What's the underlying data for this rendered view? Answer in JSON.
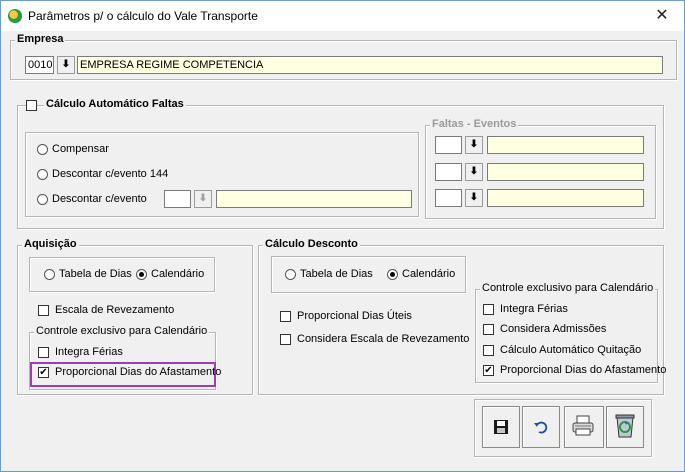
{
  "window": {
    "title": "Parâmetros p/ o cálculo do Vale Transporte",
    "close_glyph": "✕"
  },
  "empresa": {
    "legend": "Empresa",
    "code": "0010",
    "name": "EMPRESA REGIME COMPETENCIA",
    "lookup_glyph": "⬇"
  },
  "calculo_auto": {
    "checkbox_label": "Cálculo Automático Faltas",
    "checked": false,
    "options": [
      {
        "label": "Compensar",
        "selected": false
      },
      {
        "label": "Descontar c/evento 144",
        "selected": false
      },
      {
        "label": "Descontar c/evento",
        "selected": false
      }
    ],
    "evento_code": "",
    "evento_desc": ""
  },
  "faltas_eventos": {
    "legend": "Faltas - Eventos",
    "rows": [
      "",
      "",
      ""
    ]
  },
  "aquisicao": {
    "legend": "Aquisição",
    "radio_tabela": "Tabela de Dias",
    "radio_calendario": "Calendário",
    "selected": "calendario",
    "escala_label": "Escala de Revezamento",
    "controle": {
      "legend": "Controle exclusivo para Calendário",
      "integra_ferias": "Integra Férias",
      "proporcional": "Proporcional Dias do Afastamento",
      "proporcional_checked": true
    }
  },
  "calculo_desconto": {
    "legend": "Cálculo Desconto",
    "radio_tabela": "Tabela de Dias",
    "radio_calendario": "Calendário",
    "selected": "calendario",
    "proporcional_uteis": "Proporcional Dias Úteis",
    "considera_escala": "Considera Escala de Revezamento",
    "controle": {
      "legend": "Controle exclusivo para Calendário",
      "integra_ferias": "Integra Férias",
      "considera_admissoes": "Considera Admissões",
      "calculo_quitacao": "Cálculo Automático Quitação",
      "proporcional": "Proporcional Dias do Afastamento",
      "proporcional_checked": true
    }
  },
  "toolbar": {
    "check_glyph": "✔"
  }
}
